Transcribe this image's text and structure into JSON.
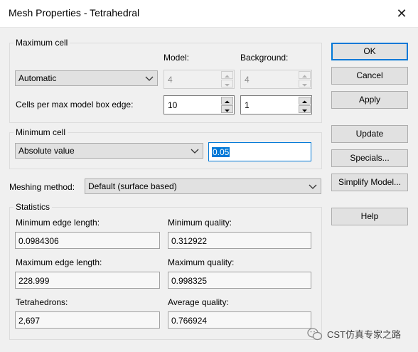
{
  "window": {
    "title": "Mesh Properties - Tetrahedral"
  },
  "max_cell": {
    "title": "Maximum cell",
    "model_header": "Model:",
    "background_header": "Background:",
    "mode": "Automatic",
    "model_value": "4",
    "background_value": "4",
    "cells_label": "Cells per max model box edge:",
    "cells_model": "10",
    "cells_background": "1"
  },
  "min_cell": {
    "title": "Minimum cell",
    "mode": "Absolute value",
    "value": "0.05"
  },
  "meshing": {
    "label": "Meshing method:",
    "value": "Default (surface based)"
  },
  "stats": {
    "title": "Statistics",
    "min_edge_label": "Minimum edge length:",
    "min_edge": "0.0984306",
    "min_quality_label": "Minimum quality:",
    "min_quality": "0.312922",
    "max_edge_label": "Maximum edge length:",
    "max_edge": "228.999",
    "max_quality_label": "Maximum quality:",
    "max_quality": "0.998325",
    "tetra_label": "Tetrahedrons:",
    "tetra": "2,697",
    "avg_quality_label": "Average quality:",
    "avg_quality": "0.766924"
  },
  "buttons": {
    "ok": "OK",
    "cancel": "Cancel",
    "apply": "Apply",
    "update": "Update",
    "specials": "Specials...",
    "simplify": "Simplify Model...",
    "help": "Help"
  },
  "watermark": {
    "text": "CST仿真专家之路"
  },
  "colors": {
    "accent": "#0078d7",
    "title_bg": "#ffffff",
    "dialog_bg": "#f0f0f0"
  }
}
